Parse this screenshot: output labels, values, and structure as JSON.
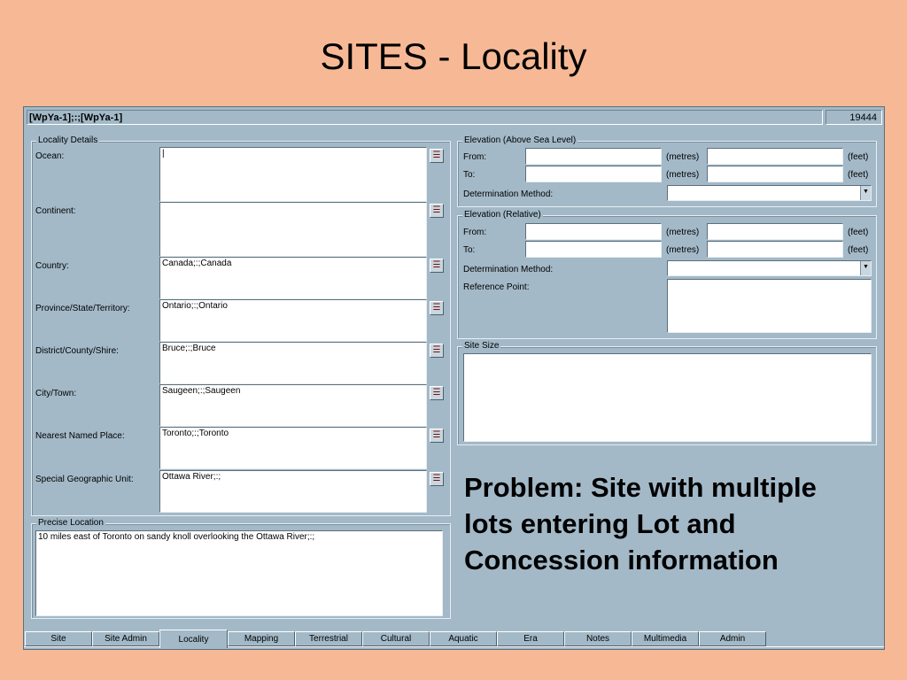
{
  "slide": {
    "title": "SITES - Locality",
    "problem_text": "Problem: Site with multiple lots entering Lot and Concession information"
  },
  "window": {
    "record_title": "[WpYa-1];:;[WpYa-1]",
    "record_number": "19444"
  },
  "locality_details": {
    "legend": "Locality Details",
    "lookup_icon": "lookup-list-icon",
    "fields": [
      {
        "label": "Ocean:",
        "value": "|"
      },
      {
        "label": "Continent:",
        "value": ""
      },
      {
        "label": "Country:",
        "value": "Canada;:;Canada"
      },
      {
        "label": "Province/State/Territory:",
        "value": "Ontario;:;Ontario"
      },
      {
        "label": "District/County/Shire:",
        "value": "Bruce;:;Bruce"
      },
      {
        "label": "City/Town:",
        "value": "Saugeen;:;Saugeen"
      },
      {
        "label": "Nearest Named Place:",
        "value": "Toronto;:;Toronto"
      },
      {
        "label": "Special Geographic Unit:",
        "value": "Ottawa River;:;"
      }
    ]
  },
  "precise_location": {
    "legend": "Precise Location",
    "value": "10 miles east of Toronto on sandy knoll overlooking the Ottawa River;:;"
  },
  "elevation_sea": {
    "legend": "Elevation (Above Sea Level)",
    "from_label": "From:",
    "to_label": "To:",
    "metres": "(metres)",
    "feet": "(feet)",
    "method_label": "Determination Method:"
  },
  "elevation_relative": {
    "legend": "Elevation (Relative)",
    "from_label": "From:",
    "to_label": "To:",
    "metres": "(metres)",
    "feet": "(feet)",
    "method_label": "Determination Method:",
    "reference_label": "Reference Point:"
  },
  "site_size": {
    "legend": "Site Size"
  },
  "tabs": [
    "Site",
    "Site Admin",
    "Locality",
    "Mapping",
    "Terrestrial",
    "Cultural",
    "Aquatic",
    "Era",
    "Notes",
    "Multimedia",
    "Admin"
  ],
  "active_tab": "Locality"
}
